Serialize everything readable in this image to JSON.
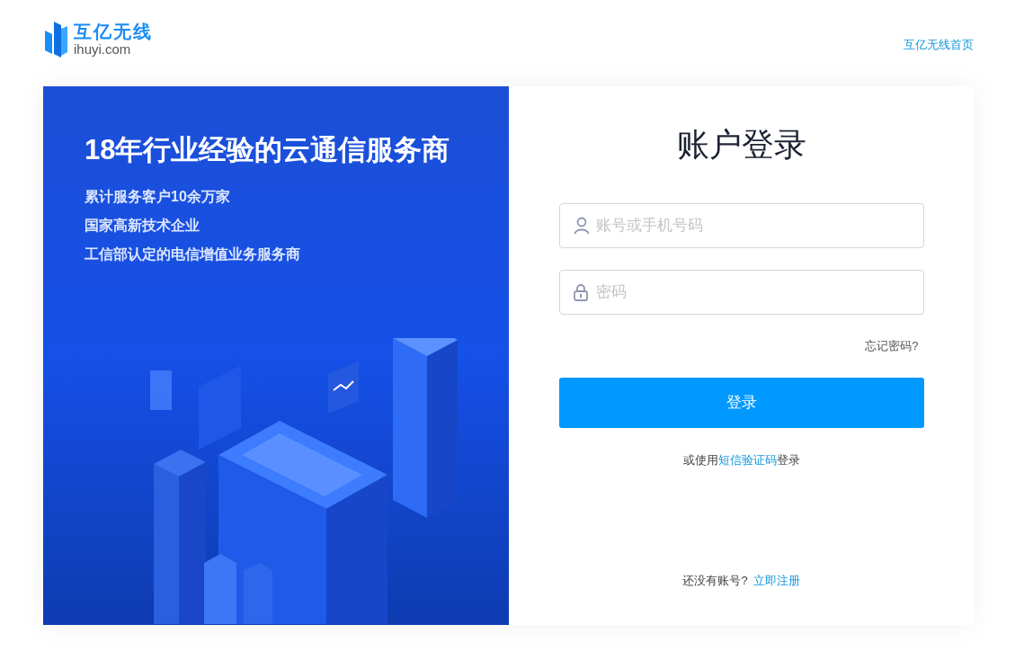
{
  "header": {
    "logo_name": "互亿无线",
    "logo_domain": "ihuyi.com",
    "home_link": "互亿无线首页"
  },
  "promo": {
    "title": "18年行业经验的云通信服务商",
    "points": [
      "累计服务客户10余万家",
      "国家高新技术企业",
      "工信部认定的电信增值业务服务商"
    ]
  },
  "login": {
    "title": "账户登录",
    "fields": [
      {
        "kind": "user",
        "placeholder": "账号或手机号码"
      },
      {
        "kind": "password",
        "placeholder": "密码"
      }
    ],
    "forgot": "忘记密码?",
    "submit": "登录",
    "sms_login": {
      "prefix": "或使用",
      "link": "短信验证码",
      "suffix": "登录"
    },
    "register": {
      "prompt": "还没有账号?",
      "link": "立即注册"
    }
  }
}
